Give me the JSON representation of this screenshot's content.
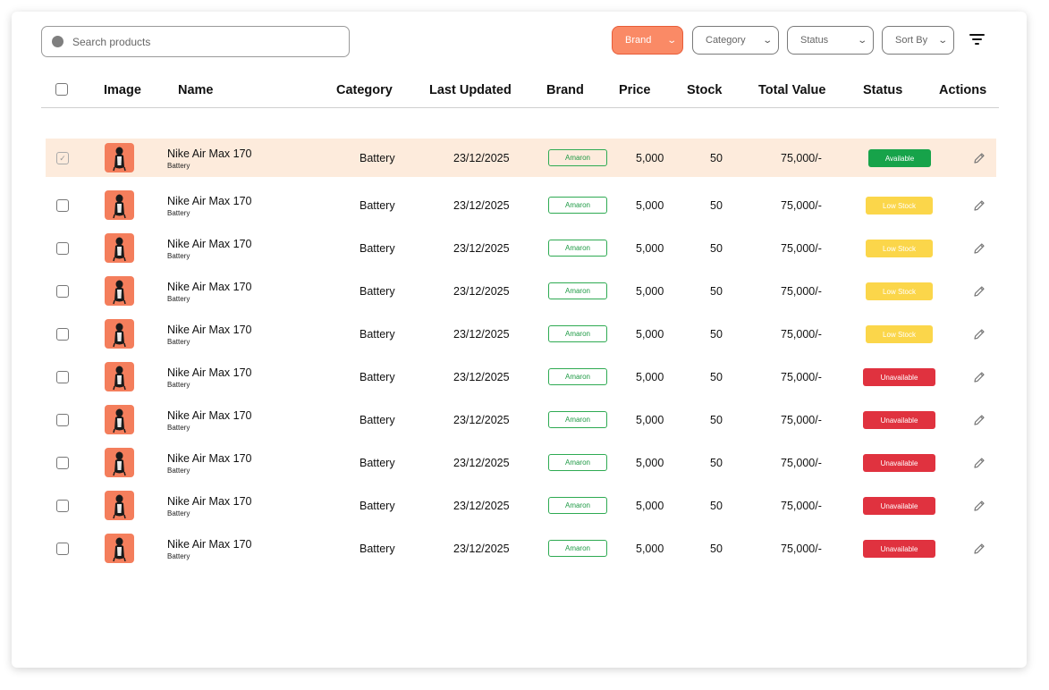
{
  "search": {
    "placeholder": "Search products"
  },
  "filters": {
    "brand": "Brand",
    "category": "Category",
    "status": "Status",
    "sort": "Sort By"
  },
  "icons": {
    "search": "search-icon",
    "chevron": "chevron-down-icon",
    "filter": "filter-icon",
    "edit": "pencil-icon",
    "check": "checkmark-icon"
  },
  "colors": {
    "accent": "#fa8a66",
    "selected_row": "#fdebdc",
    "brand_badge": "#2eaa52",
    "available": "#17a34a",
    "low_stock": "#fbd64a",
    "unavailable": "#e0323f"
  },
  "table": {
    "headers": {
      "image": "Image",
      "name": "Name",
      "category": "Category",
      "last_updated": "Last Updated",
      "brand": "Brand",
      "price": "Price",
      "stock": "Stock",
      "total_value": "Total Value",
      "status": "Status",
      "actions": "Actions"
    },
    "rows": [
      {
        "selected": true,
        "name": "Nike Air Max 170",
        "sub": "Battery",
        "category": "Battery",
        "last_updated": "23/12/2025",
        "brand": "Amaron",
        "price": "5,000",
        "stock": "50",
        "total_value": "75,000/-",
        "status": "Available",
        "status_kind": "available"
      },
      {
        "selected": false,
        "name": "Nike Air Max 170",
        "sub": "Battery",
        "category": "Battery",
        "last_updated": "23/12/2025",
        "brand": "Amaron",
        "price": "5,000",
        "stock": "50",
        "total_value": "75,000/-",
        "status": "Low Stock",
        "status_kind": "low"
      },
      {
        "selected": false,
        "name": "Nike Air Max 170",
        "sub": "Battery",
        "category": "Battery",
        "last_updated": "23/12/2025",
        "brand": "Amaron",
        "price": "5,000",
        "stock": "50",
        "total_value": "75,000/-",
        "status": "Low Stock",
        "status_kind": "low"
      },
      {
        "selected": false,
        "name": "Nike Air Max 170",
        "sub": "Battery",
        "category": "Battery",
        "last_updated": "23/12/2025",
        "brand": "Amaron",
        "price": "5,000",
        "stock": "50",
        "total_value": "75,000/-",
        "status": "Low Stock",
        "status_kind": "low"
      },
      {
        "selected": false,
        "name": "Nike Air Max 170",
        "sub": "Battery",
        "category": "Battery",
        "last_updated": "23/12/2025",
        "brand": "Amaron",
        "price": "5,000",
        "stock": "50",
        "total_value": "75,000/-",
        "status": "Low Stock",
        "status_kind": "low"
      },
      {
        "selected": false,
        "name": "Nike Air Max 170",
        "sub": "Battery",
        "category": "Battery",
        "last_updated": "23/12/2025",
        "brand": "Amaron",
        "price": "5,000",
        "stock": "50",
        "total_value": "75,000/-",
        "status": "Unavailable",
        "status_kind": "unavailable"
      },
      {
        "selected": false,
        "name": "Nike Air Max 170",
        "sub": "Battery",
        "category": "Battery",
        "last_updated": "23/12/2025",
        "brand": "Amaron",
        "price": "5,000",
        "stock": "50",
        "total_value": "75,000/-",
        "status": "Unavailable",
        "status_kind": "unavailable"
      },
      {
        "selected": false,
        "name": "Nike Air Max 170",
        "sub": "Battery",
        "category": "Battery",
        "last_updated": "23/12/2025",
        "brand": "Amaron",
        "price": "5,000",
        "stock": "50",
        "total_value": "75,000/-",
        "status": "Unavailable",
        "status_kind": "unavailable"
      },
      {
        "selected": false,
        "name": "Nike Air Max 170",
        "sub": "Battery",
        "category": "Battery",
        "last_updated": "23/12/2025",
        "brand": "Amaron",
        "price": "5,000",
        "stock": "50",
        "total_value": "75,000/-",
        "status": "Unavailable",
        "status_kind": "unavailable"
      },
      {
        "selected": false,
        "name": "Nike Air Max 170",
        "sub": "Battery",
        "category": "Battery",
        "last_updated": "23/12/2025",
        "brand": "Amaron",
        "price": "5,000",
        "stock": "50",
        "total_value": "75,000/-",
        "status": "Unavailable",
        "status_kind": "unavailable"
      }
    ]
  }
}
